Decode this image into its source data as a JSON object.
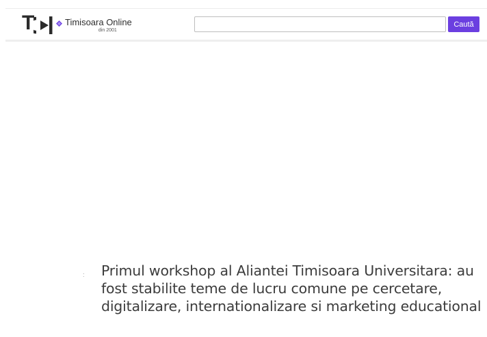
{
  "header": {
    "logo": {
      "mark": "T",
      "site_name": "Timisoara Online",
      "since": "din 2001"
    },
    "search": {
      "value": "",
      "placeholder": "",
      "button_label": "Caută"
    },
    "colors": {
      "accent": "#6b3fe0",
      "logo_gem": "#6b3fe0",
      "text_dark": "#2b2b2b"
    }
  },
  "article": {
    "marker": ":",
    "title": "Primul workshop al Aliantei Timisoara Universitara: au fost stabilite teme de lucru comune pe cercetare, digitalizare, internationalizare si marketing educational"
  },
  "icons": {
    "logo_mark": "play-triangle-icon",
    "logo_gem": "diamond-icon"
  }
}
